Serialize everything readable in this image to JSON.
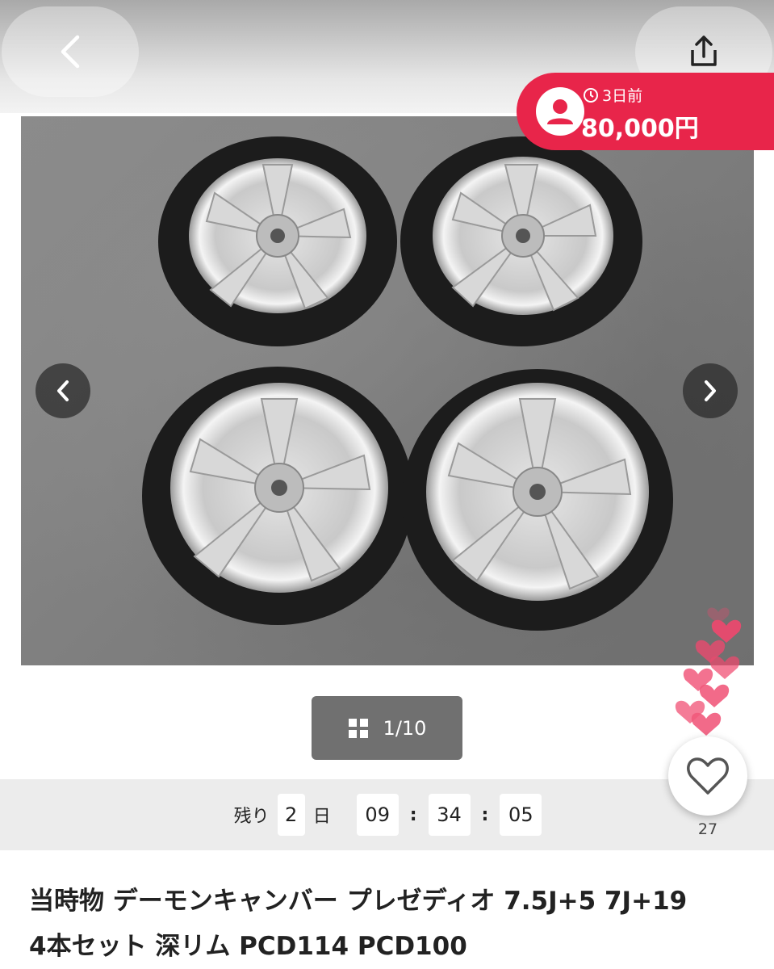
{
  "header": {
    "back_icon": "chevron-left-icon",
    "share_icon": "share-icon"
  },
  "badge": {
    "elapsed": "3日前",
    "price": "80,000円",
    "color": "#e8254a"
  },
  "gallery": {
    "counter": "1/10",
    "prev_icon": "chevron-left-icon",
    "next_icon": "chevron-right-icon"
  },
  "timer": {
    "prefix": "残り",
    "days": "2",
    "day_unit": "日",
    "hours": "09",
    "minutes": "34",
    "seconds": "05",
    "sep": ":"
  },
  "like": {
    "count": "27"
  },
  "title": {
    "line1": "当時物 デーモンキャンバー プレゼディオ 7.5J+5 7J+19",
    "line2": "4本セット 深リム PCD114 PCD100"
  }
}
